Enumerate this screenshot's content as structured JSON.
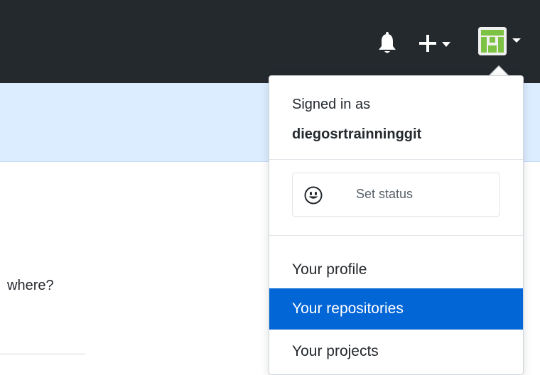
{
  "header": {
    "notifications_icon": "bell-icon",
    "create_icon": "plus-icon",
    "avatar_icon": "identicon-avatar",
    "avatar_colors": {
      "green": "#7dc242"
    },
    "colors": {
      "bar": "#24292e",
      "icon": "#ffffff"
    }
  },
  "page": {
    "partial_text": "where?",
    "banner_color": "#dbedff"
  },
  "user_menu": {
    "signed_in_label": "Signed in as",
    "username": "diegosrtrainninggit",
    "set_status_label": "Set status",
    "set_status_icon": "smiley-icon",
    "items": [
      {
        "label": "Your profile",
        "active": false
      },
      {
        "label": "Your repositories",
        "active": true
      },
      {
        "label": "Your projects",
        "active": false
      }
    ],
    "colors": {
      "active_bg": "#0366d6",
      "active_text": "#ffffff",
      "text": "#24292e"
    }
  }
}
